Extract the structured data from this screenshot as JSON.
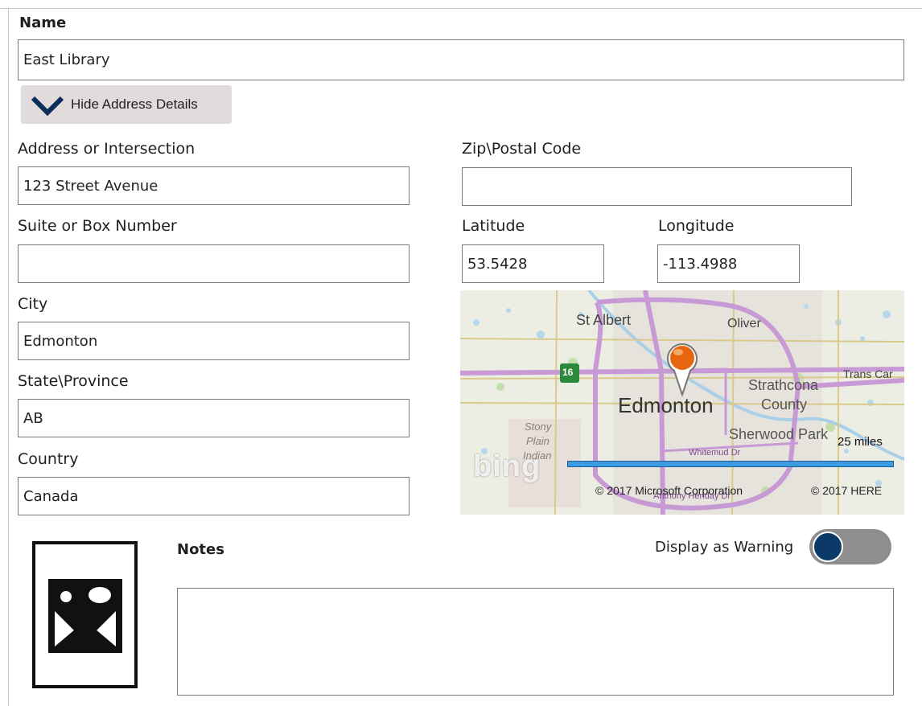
{
  "form": {
    "name_label": "Name",
    "name_value": "East Library",
    "hide_details_label": "Hide Address Details",
    "address_label": "Address or Intersection",
    "address_value": "123 Street Avenue",
    "suite_label": "Suite or Box Number",
    "suite_value": "",
    "city_label": "City",
    "city_value": "Edmonton",
    "state_label": "State\\Province",
    "state_value": "AB",
    "country_label": "Country",
    "country_value": "Canada",
    "zip_label": "Zip\\Postal Code",
    "zip_value": "",
    "latitude_label": "Latitude",
    "latitude_value": "53.5428",
    "longitude_label": "Longitude",
    "longitude_value": "-113.4988",
    "notes_label": "Notes",
    "notes_value": "",
    "warning_label": "Display as Warning",
    "warning_on": false
  },
  "map": {
    "labels": {
      "st_albert": "St Albert",
      "oliver": "Oliver",
      "trans_canada": "Trans Car",
      "edmonton": "Edmonton",
      "strathcona": "Strathcona",
      "county": "County",
      "sherwood_park": "Sherwood Park",
      "stony": "Stony",
      "plain": "Plain",
      "indian": "Indian",
      "highway_16": "16",
      "whitemud": "Whitemud Dr",
      "anthony_henday": "Anthony Henday Dr"
    },
    "scale_label": "25 miles",
    "copyright_ms": "© 2017 Microsoft Corporation",
    "copyright_here": "© 2017 HERE",
    "brand": "bing",
    "colors": {
      "pin": "#e8650f",
      "highway": "#c79ad6",
      "scale_bar": "#3f9be0"
    }
  },
  "icons": {
    "chevron": "chevron-down-icon",
    "image_placeholder": "image-placeholder-icon",
    "map_pin": "map-pin-icon"
  }
}
